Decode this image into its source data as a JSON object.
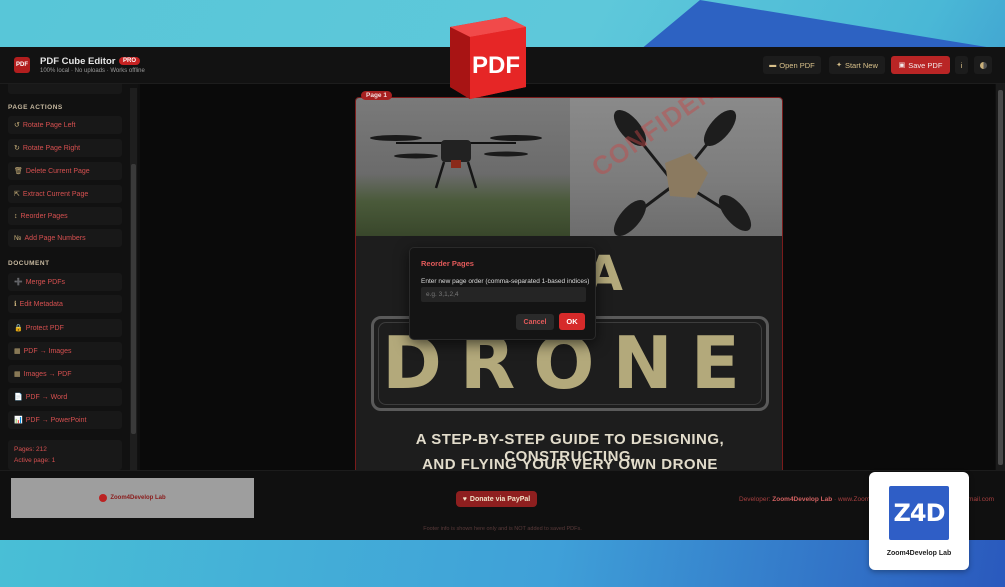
{
  "app": {
    "logo_text": "PDF",
    "title": "PDF Cube Editor",
    "badge": "PRO",
    "subtitle": "100% local · No uploads · Works offline"
  },
  "toolbar": {
    "open_label": "Open PDF",
    "start_new_label": "Start New",
    "save_label": "Save PDF",
    "info_label": "i"
  },
  "sidebar": {
    "page_actions_heading": "PAGE ACTIONS",
    "page_actions": [
      {
        "icon": "↺",
        "label": "Rotate Page Left"
      },
      {
        "icon": "↻",
        "label": "Rotate Page Right"
      },
      {
        "icon": "🗑",
        "label": "Delete Current Page"
      },
      {
        "icon": "⇱",
        "label": "Extract Current Page"
      },
      {
        "icon": "↕",
        "label": "Reorder Pages"
      },
      {
        "icon": "№",
        "label": "Add Page Numbers"
      }
    ],
    "document_heading": "DOCUMENT",
    "document_actions": [
      {
        "icon": "➕",
        "label": "Merge PDFs"
      },
      {
        "icon": "ℹ",
        "label": "Edit Metadata"
      },
      {
        "icon": "🔒",
        "label": "Protect PDF"
      },
      {
        "icon": "▦",
        "label": "PDF → Images"
      },
      {
        "icon": "▦",
        "label": "Images → PDF"
      },
      {
        "icon": "📄",
        "label": "PDF → Word"
      },
      {
        "icon": "📊",
        "label": "PDF → PowerPoint"
      }
    ],
    "stats": {
      "pages": "Pages: 212",
      "active_page": "Active page: 1"
    }
  },
  "viewer": {
    "page_label": "Page 1",
    "watermark": "CONFIDENTIAL",
    "title_line1": "D A",
    "title_line2": "DRONE",
    "subtitle_line1": "A STEP-BY-STEP GUIDE TO DESIGNING, CONSTRUCTING,",
    "subtitle_line2": "AND FLYING YOUR VERY OWN DRONE"
  },
  "dialog": {
    "title": "Reorder Pages",
    "description": "Enter new page order (comma-separated 1-based indices)",
    "input_placeholder": "e.g. 3,1,2,4",
    "input_value": "",
    "cancel_label": "Cancel",
    "ok_label": "OK"
  },
  "footer": {
    "ad_text": "Zoom4Develop Lab",
    "donate_label": "Donate via PayPal",
    "developer_prefix": "Developer:",
    "developer_name": "Zoom4Develop Lab",
    "developer_rest": " · www.Zoom",
    "developer_mail": "mail.com",
    "note": "Footer info is shown here only and is NOT added to saved PDFs."
  },
  "overlay": {
    "pdf_cube_text": "PDF",
    "brand_tile": "Z4D",
    "brand_name": "Zoom4Develop Lab"
  },
  "colors": {
    "accent": "#d62a2a",
    "background": "#0f0f0f",
    "gold": "#c9b07a"
  }
}
